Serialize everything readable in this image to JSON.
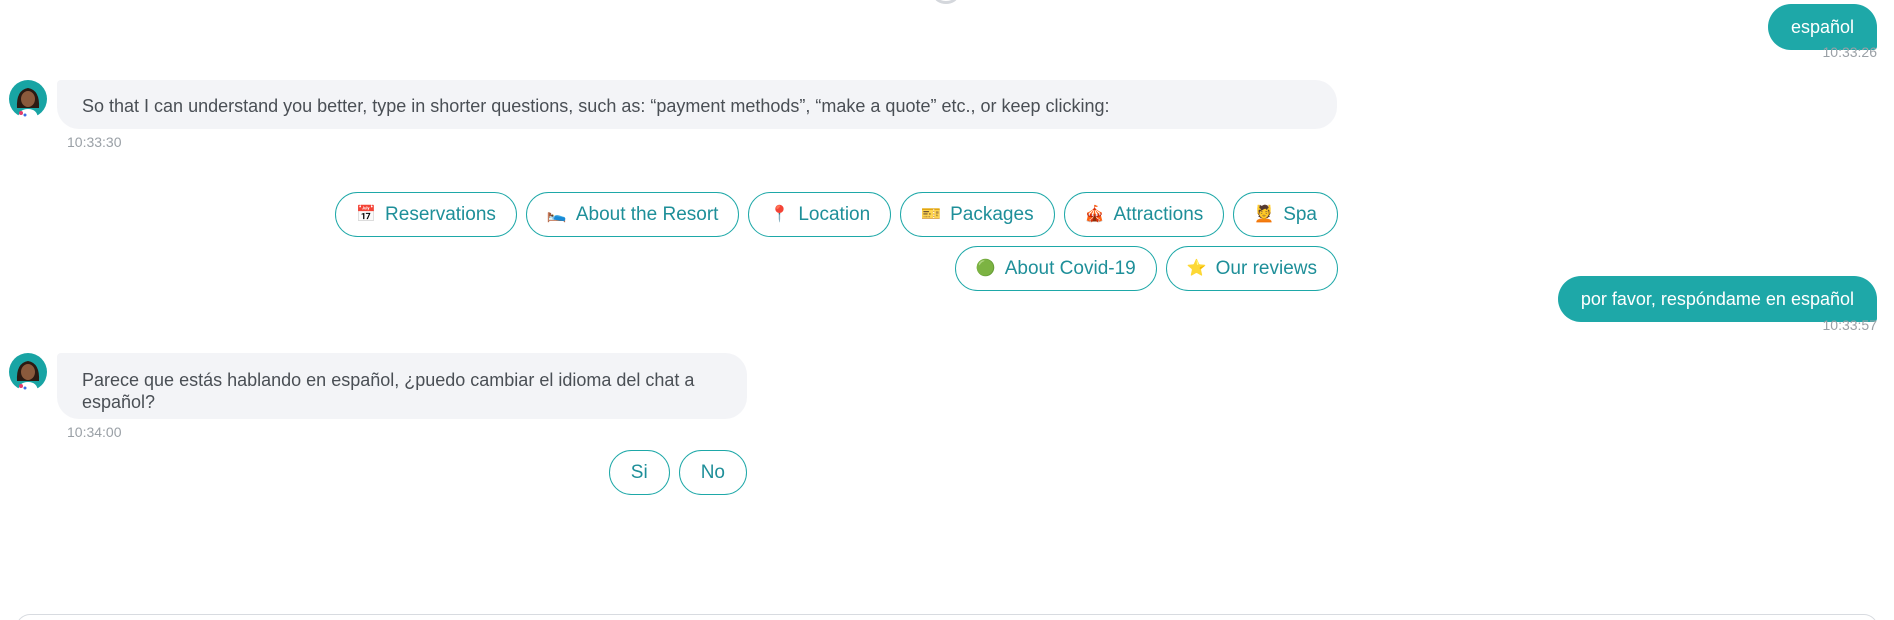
{
  "messages": {
    "user1": {
      "text": "español",
      "time": "10:33:26"
    },
    "bot1": {
      "text": "So that I can understand you better, type in shorter questions, such as: “payment methods”, “make a quote” etc., or keep clicking:",
      "time": "10:33:30"
    },
    "user2": {
      "text": "por favor, respóndame en español",
      "time": "10:33:57"
    },
    "bot2": {
      "text": "Parece que estás hablando en español, ¿puedo cambiar el idioma del chat a español?",
      "time": "10:34:00"
    }
  },
  "quick_replies": [
    {
      "emoji": "📅",
      "label": "Reservations"
    },
    {
      "emoji": "🛌",
      "label": "About the Resort"
    },
    {
      "emoji": "📍",
      "label": "Location"
    },
    {
      "emoji": "🎫",
      "label": "Packages"
    },
    {
      "emoji": "🎪",
      "label": "Attractions"
    },
    {
      "emoji": "💆",
      "label": "Spa"
    },
    {
      "emoji": "🟢",
      "label": "About Covid-19"
    },
    {
      "emoji": "⭐",
      "label": "Our reviews"
    }
  ],
  "language_options": [
    {
      "label": "Si"
    },
    {
      "label": "No"
    }
  ],
  "colors": {
    "accent": "#1ea8a8",
    "bot_bubble": "#f3f4f7",
    "timestamp": "#9aa0a6"
  }
}
